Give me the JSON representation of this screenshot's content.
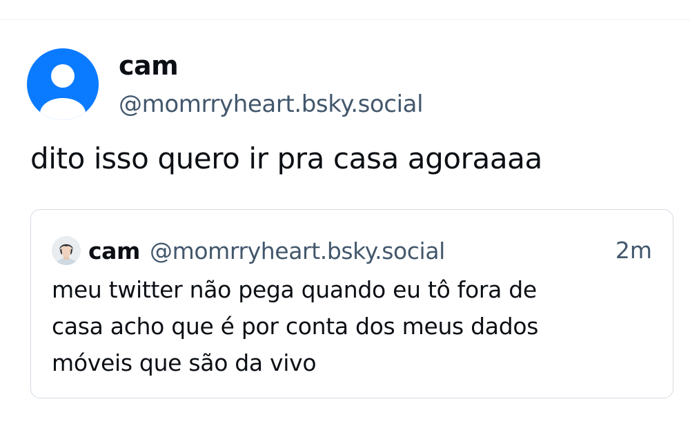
{
  "post": {
    "author": {
      "display_name": "cam",
      "handle": "@momrryheart.bsky.social",
      "avatar_icon": "default-user-avatar-icon",
      "avatar_color": "#0a7aff"
    },
    "text": "dito isso quero ir pra casa agoraaaa"
  },
  "quote": {
    "author": {
      "display_name": "cam",
      "handle": "@momrryheart.bsky.social",
      "avatar_icon": "profile-photo-avatar"
    },
    "timestamp": "2m",
    "text_lines": [
      "meu twitter não pega quando eu tô fora de",
      "casa acho que é por conta dos meus dados",
      "móveis que são da vivo"
    ]
  },
  "colors": {
    "primary_text": "#0b0f14",
    "secondary_text": "#42576c",
    "border": "#d4dbe2",
    "accent": "#0a7aff"
  }
}
